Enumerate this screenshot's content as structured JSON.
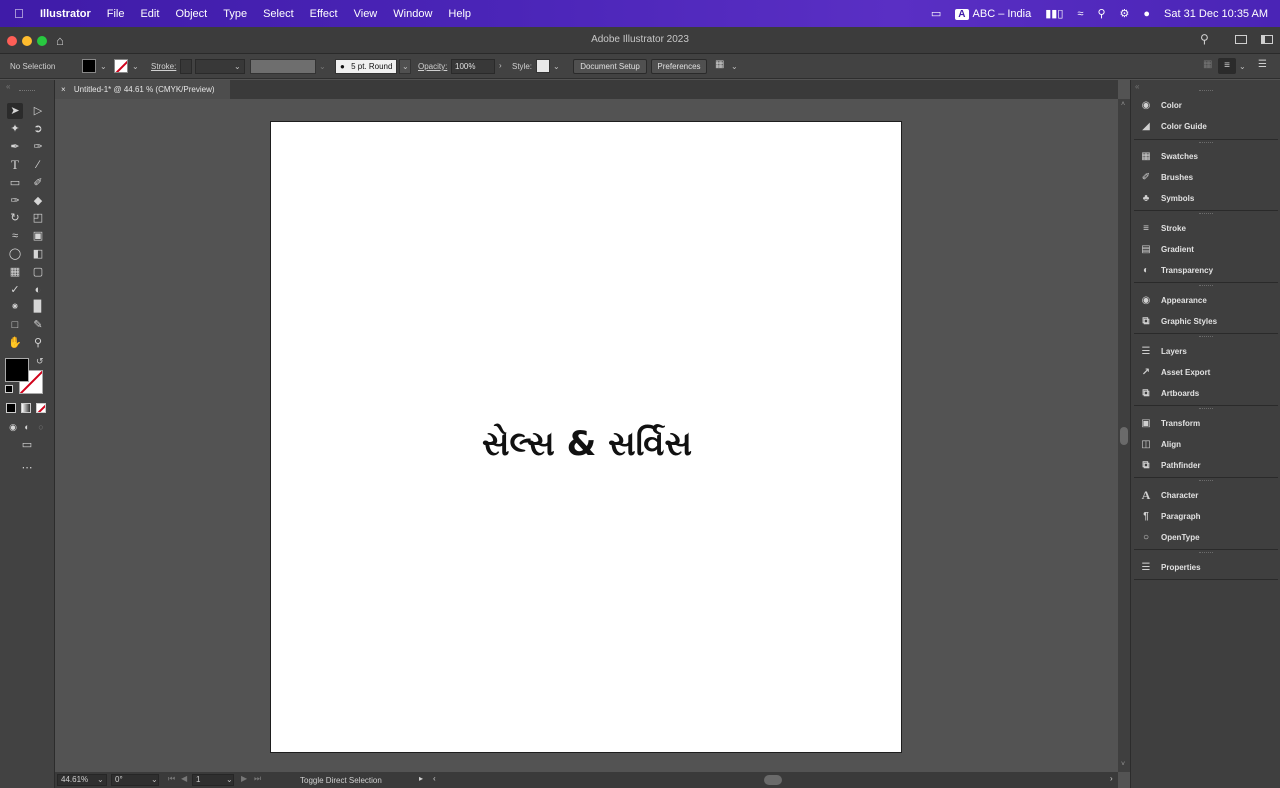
{
  "menubar": {
    "app_name": "Illustrator",
    "items": [
      "File",
      "Edit",
      "Object",
      "Type",
      "Select",
      "Effect",
      "View",
      "Window",
      "Help"
    ],
    "input_source": "ABC – India",
    "datetime": "Sat 31 Dec  10:35 AM"
  },
  "window": {
    "title": "Adobe Illustrator 2023"
  },
  "controlbar": {
    "selection_label": "No Selection",
    "stroke_label": "Stroke:",
    "brush_label": "5 pt. Round",
    "opacity_label": "Opacity:",
    "opacity_value": "100%",
    "style_label": "Style:",
    "document_setup": "Document Setup",
    "preferences": "Preferences"
  },
  "document_tab": {
    "label": "Untitled-1* @ 44.61 % (CMYK/Preview)"
  },
  "artboard": {
    "text": "સેલ્સ & સર્વિસ"
  },
  "panels": [
    {
      "icon": "color-icon",
      "label": "Color"
    },
    {
      "icon": "color-guide-icon",
      "label": "Color Guide"
    },
    {
      "icon": "swatches-icon",
      "label": "Swatches"
    },
    {
      "icon": "brushes-icon",
      "label": "Brushes"
    },
    {
      "icon": "symbols-icon",
      "label": "Symbols"
    },
    {
      "icon": "stroke-icon",
      "label": "Stroke"
    },
    {
      "icon": "gradient-icon",
      "label": "Gradient"
    },
    {
      "icon": "transparency-icon",
      "label": "Transparency"
    },
    {
      "icon": "appearance-icon",
      "label": "Appearance"
    },
    {
      "icon": "graphic-styles-icon",
      "label": "Graphic Styles"
    },
    {
      "icon": "layers-icon",
      "label": "Layers"
    },
    {
      "icon": "asset-export-icon",
      "label": "Asset Export"
    },
    {
      "icon": "artboards-icon",
      "label": "Artboards"
    },
    {
      "icon": "transform-icon",
      "label": "Transform"
    },
    {
      "icon": "align-icon",
      "label": "Align"
    },
    {
      "icon": "pathfinder-icon",
      "label": "Pathfinder"
    },
    {
      "icon": "character-icon",
      "label": "Character"
    },
    {
      "icon": "paragraph-icon",
      "label": "Paragraph"
    },
    {
      "icon": "opentype-icon",
      "label": "OpenType"
    },
    {
      "icon": "properties-icon",
      "label": "Properties"
    }
  ],
  "statusbar": {
    "zoom": "44.61%",
    "rotation": "0°",
    "artboard_number": "1",
    "status_text": "Toggle Direct Selection"
  },
  "colors": {
    "menubar": "#4b25b8",
    "ui_dark": "#424242",
    "canvas": "#535353",
    "artboard": "#ffffff"
  }
}
